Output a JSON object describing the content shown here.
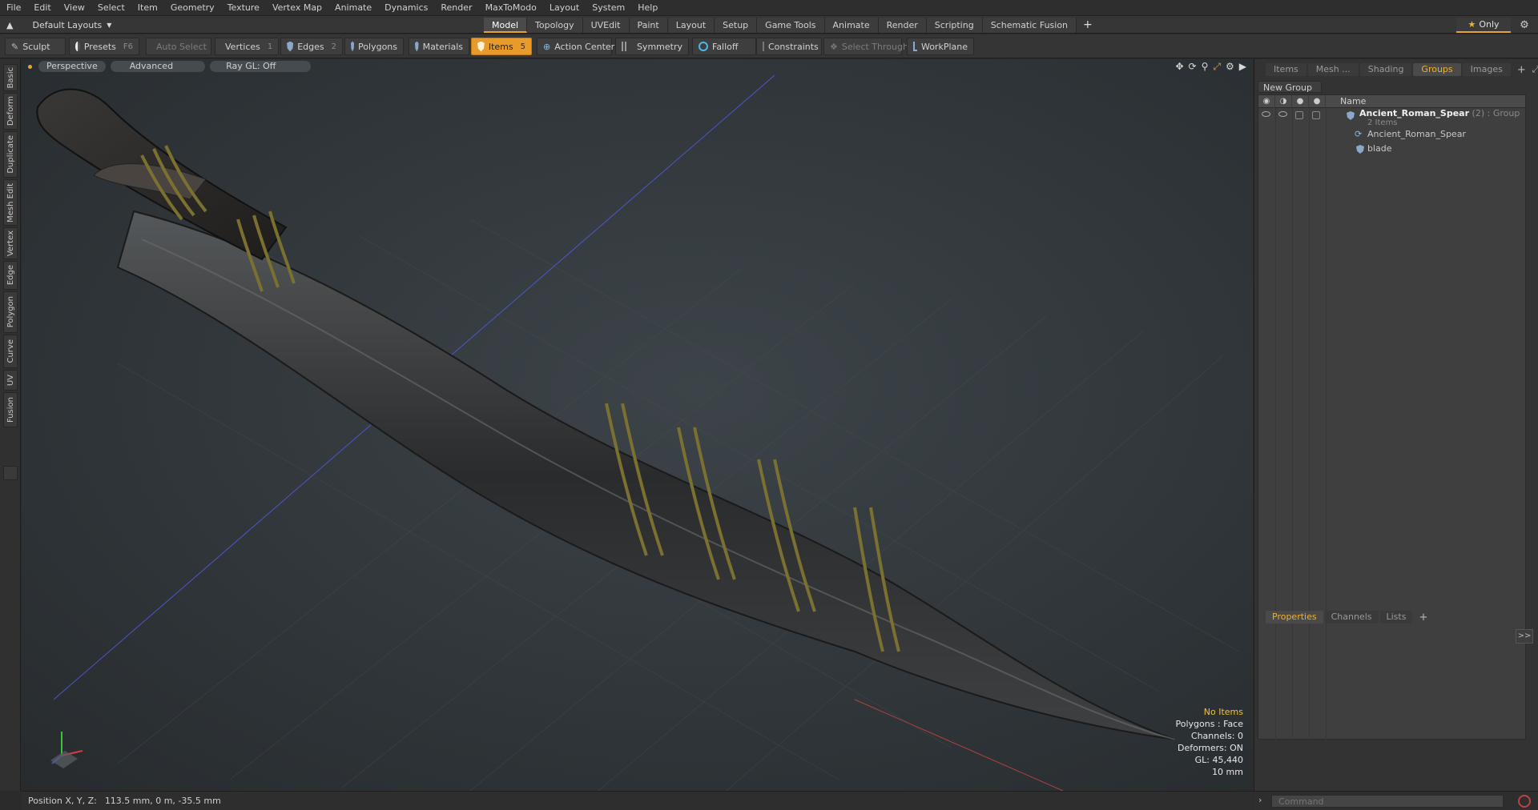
{
  "menubar": [
    "File",
    "Edit",
    "View",
    "Select",
    "Item",
    "Geometry",
    "Texture",
    "Vertex Map",
    "Animate",
    "Dynamics",
    "Render",
    "MaxToModo",
    "Layout",
    "System",
    "Help"
  ],
  "layout_select": "Default Layouts",
  "layout_tabs": [
    "Model",
    "Topology",
    "UVEdit",
    "Paint",
    "Layout",
    "Setup",
    "Game Tools",
    "Animate",
    "Render",
    "Scripting",
    "Schematic Fusion"
  ],
  "only_label": "Only",
  "toolbar": {
    "sculpt": "Sculpt",
    "presets": "Presets",
    "presets_key": "F6",
    "auto_select": "Auto Select",
    "vertices": "Vertices",
    "vertices_key": "1",
    "edges": "Edges",
    "edges_key": "2",
    "polygons": "Polygons",
    "materials": "Materials",
    "items": "Items",
    "items_key": "5",
    "action_center": "Action Center",
    "symmetry": "Symmetry",
    "falloff": "Falloff",
    "constraints": "Constraints",
    "select_through": "Select Through",
    "workplane": "WorkPlane"
  },
  "left_tabs": [
    "Basic",
    "Deform",
    "Duplicate",
    "Mesh Edit",
    "Vertex",
    "Edge",
    "Polygon",
    "Curve",
    "UV",
    "Fusion"
  ],
  "viewport": {
    "perspective": "Perspective",
    "advanced": "Advanced",
    "raygl": "Ray GL: Off",
    "info": {
      "no_items": "No Items",
      "polygons": "Polygons : Face",
      "channels": "Channels: 0",
      "deformers": "Deformers: ON",
      "gl": "GL: 45,440",
      "scale": "10 mm"
    }
  },
  "right_panel": {
    "tabs": [
      "Items",
      "Mesh ...",
      "Shading",
      "Groups",
      "Images"
    ],
    "active_tab": "Groups",
    "new_group": "New Group",
    "name_header": "Name",
    "group": {
      "name": "Ancient_Roman_Spear",
      "count": "(2)",
      "type": ": Group",
      "items_label": "2 Items",
      "children": [
        "Ancient_Roman_Spear",
        "blade"
      ]
    },
    "bottom_tabs": [
      "Properties",
      "Channels",
      "Lists"
    ],
    "bottom_active": "Properties",
    "expand": ">>",
    "command_placeholder": "Command"
  },
  "statusbar": {
    "position_label": "Position X, Y, Z:",
    "position_value": "113.5 mm, 0 m, -35.5 mm"
  }
}
